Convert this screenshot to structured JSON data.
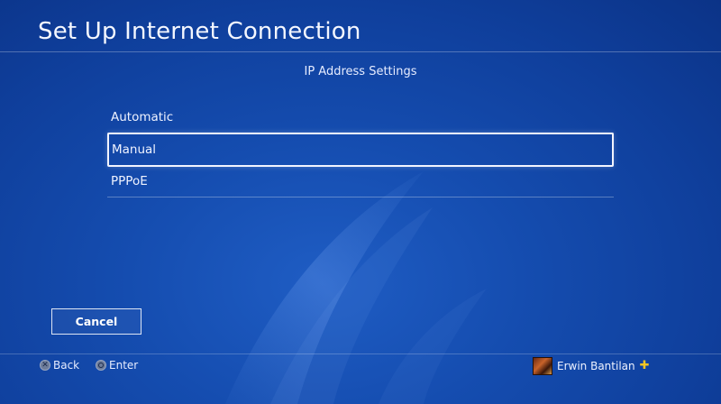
{
  "header": {
    "title": "Set Up Internet Connection",
    "subtitle": "IP Address Settings"
  },
  "menu": {
    "items": [
      {
        "label": "Automatic",
        "selected": false
      },
      {
        "label": "Manual",
        "selected": true
      },
      {
        "label": "PPPoE",
        "selected": false
      }
    ]
  },
  "actions": {
    "cancel_label": "Cancel"
  },
  "footer": {
    "back_label": "Back",
    "back_icon": "cross-button-icon",
    "enter_label": "Enter",
    "enter_icon": "circle-button-icon",
    "user_name": "Erwin Bantilan",
    "plus_icon": "playstation-plus-icon"
  },
  "colors": {
    "background": "#154db0",
    "accent_plus": "#f3c623",
    "selection_border": "#f2f4ff"
  }
}
